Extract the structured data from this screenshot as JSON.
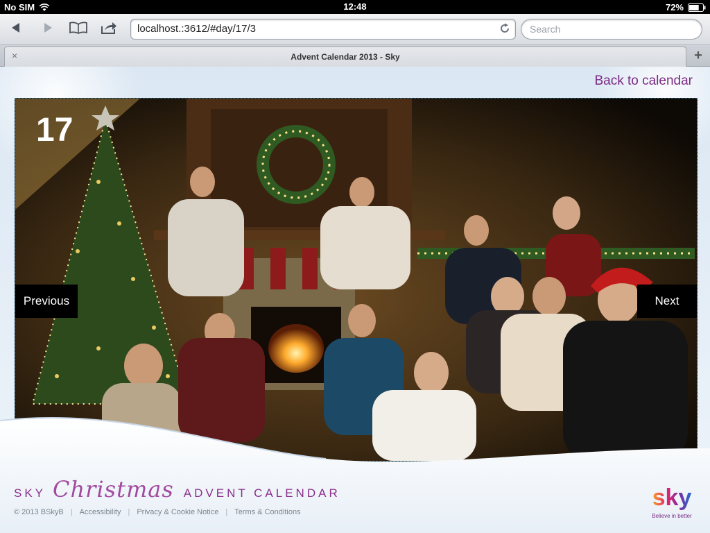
{
  "status_bar": {
    "carrier": "No SIM",
    "time": "12:48",
    "battery": "72%",
    "battery_level": 0.72
  },
  "toolbar": {
    "url": "localhost.:3612/#day/17/3",
    "search_placeholder": "Search"
  },
  "tab": {
    "title": "Advent Calendar 2013 - Sky",
    "close_glyph": "×",
    "new_tab_glyph": "+"
  },
  "page": {
    "back_link": "Back to calendar",
    "day_number": "17",
    "prev_label": "Previous",
    "next_label": "Next"
  },
  "branding": {
    "sky": "SKY",
    "christmas": "Christmas",
    "advent": "ADVENT CALENDAR",
    "logo_word": "sky",
    "tagline": "Believe in better"
  },
  "footer": {
    "copyright": "© 2013 BSkyB",
    "links": [
      "Accessibility",
      "Privacy & Cookie Notice",
      "Terms & Conditions"
    ]
  },
  "colors": {
    "accent": "#7a2a84",
    "status_bar": "#000000",
    "nav_button_bg": "#000000"
  }
}
